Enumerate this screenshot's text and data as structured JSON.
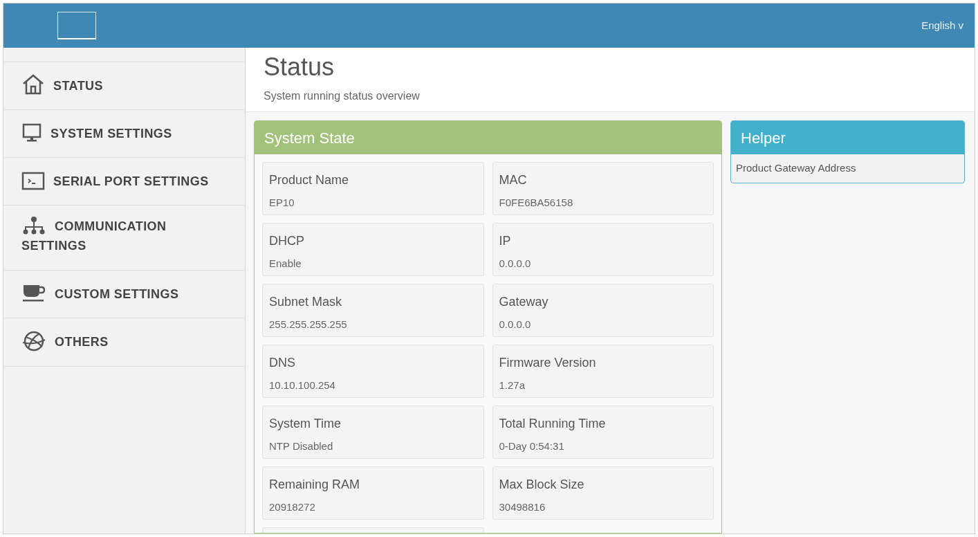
{
  "header": {
    "language": "English v"
  },
  "sidebar": {
    "items": [
      {
        "label": "STATUS",
        "kind": "home"
      },
      {
        "label": "SYSTEM SETTINGS",
        "kind": "monitor"
      },
      {
        "label": "SERIAL PORT SETTINGS",
        "kind": "terminal"
      },
      {
        "label": "COMMUNICATION SETTINGS",
        "kind": "network"
      },
      {
        "label": "CUSTOM SETTINGS",
        "kind": "cup"
      },
      {
        "label": "OTHERS",
        "kind": "globe"
      }
    ]
  },
  "page": {
    "title": "Status",
    "subtitle": "System running status overview"
  },
  "system_state": {
    "title": "System State",
    "fields": [
      {
        "label": "Product Name",
        "value": "EP10"
      },
      {
        "label": "MAC",
        "value": "F0FE6BA56158"
      },
      {
        "label": "DHCP",
        "value": "Enable"
      },
      {
        "label": "IP",
        "value": "0.0.0.0"
      },
      {
        "label": "Subnet Mask",
        "value": "255.255.255.255"
      },
      {
        "label": "Gateway",
        "value": "0.0.0.0"
      },
      {
        "label": "DNS",
        "value": "10.10.100.254"
      },
      {
        "label": "Firmware Version",
        "value": "1.27a"
      },
      {
        "label": "System Time",
        "value": "NTP Disabled"
      },
      {
        "label": "Total Running Time",
        "value": "0-Day 0:54:31"
      },
      {
        "label": "Remaining RAM",
        "value": "20918272"
      },
      {
        "label": "Max Block Size",
        "value": "30498816"
      }
    ]
  },
  "helper": {
    "title": "Helper",
    "text": "Product Gateway Address"
  }
}
